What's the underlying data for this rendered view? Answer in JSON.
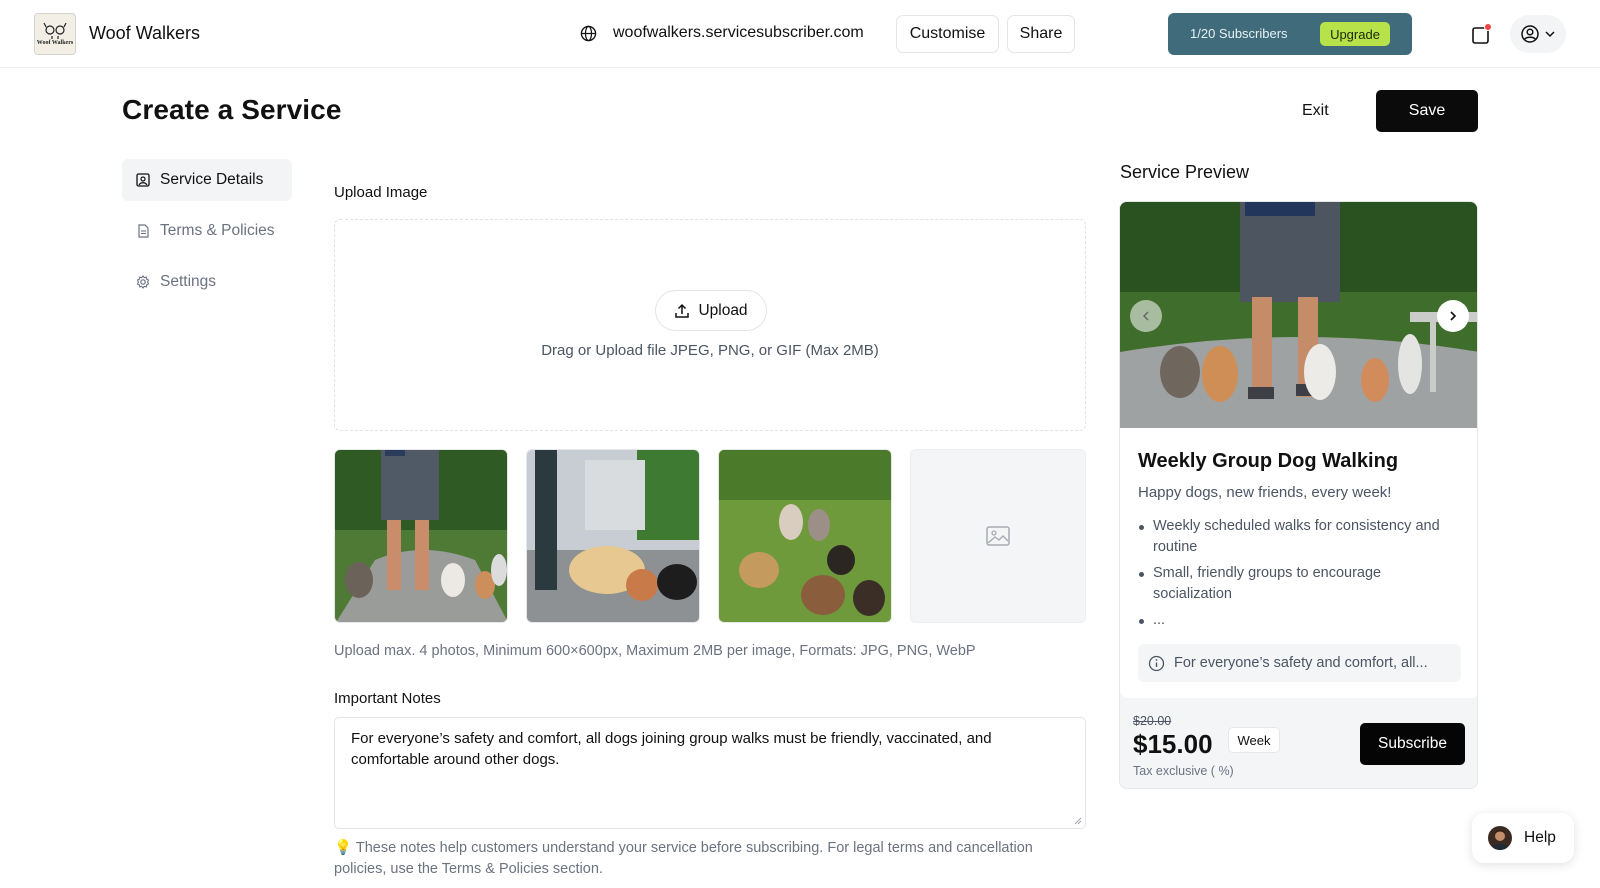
{
  "topbar": {
    "logo_text": "Woof Walkers",
    "brand": "Woof Walkers",
    "url": "woofwalkers.servicesubscriber.com",
    "customise_label": "Customise",
    "share_label": "Share",
    "subscribers": "1/20 Subscribers",
    "upgrade_label": "Upgrade",
    "icons": {
      "globe": "globe-icon",
      "notification": "notification-icon",
      "account": "account-icon"
    },
    "colors": {
      "subscribers_bg": "#3f6b7b",
      "upgrade_bg": "#b7e24a"
    }
  },
  "header": {
    "title": "Create a Service",
    "exit_label": "Exit",
    "save_label": "Save"
  },
  "sidebar": {
    "items": [
      {
        "label": "Service Details",
        "icon": "image-icon",
        "active": true
      },
      {
        "label": "Terms & Policies",
        "icon": "document-icon",
        "active": false
      },
      {
        "label": "Settings",
        "icon": "gear-icon",
        "active": false
      }
    ]
  },
  "main": {
    "upload_label": "Upload Image",
    "upload_button": "Upload",
    "drop_hint": "Drag or Upload file JPEG, PNG, or GIF (Max 2MB)",
    "photo_hint": "Upload max. 4 photos, Minimum 600×600px, Maximum 2MB per image, Formats: JPG, PNG, WebP",
    "notes_label": "Important Notes",
    "notes_value": "For everyone’s safety and comfort, all dogs joining group walks must be friendly, vaccinated, and comfortable around other dogs.",
    "notes_tip": "These notes help customers understand your service before subscribing. For legal terms and cancellation policies, use the Terms & Policies section."
  },
  "preview": {
    "title": "Service Preview",
    "service_title": "Weekly Group Dog Walking",
    "subtitle": "Happy dogs, new friends, every week!",
    "bullets": [
      "Weekly scheduled walks for consistency and routine",
      "Small, friendly groups to encourage socialization",
      "..."
    ],
    "note": "For everyone’s safety and comfort, all...",
    "old_price": "$20.00",
    "price": "$15.00",
    "period": "Week",
    "tax": "Tax exclusive ( %)",
    "subscribe_label": "Subscribe"
  },
  "help": {
    "label": "Help"
  }
}
